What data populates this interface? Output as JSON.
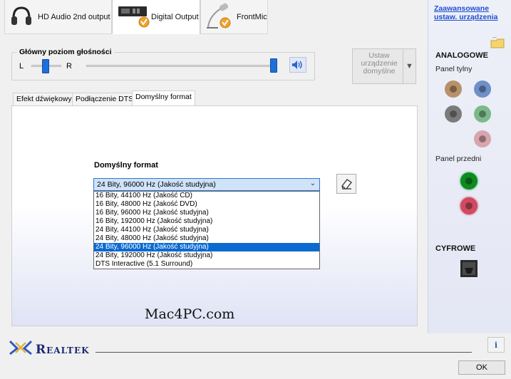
{
  "device_tabs": [
    {
      "label": "HD Audio 2nd output",
      "icon": "headphones-icon",
      "active": false
    },
    {
      "label": "Digital Output",
      "icon": "digital-output-device-icon",
      "active": true
    },
    {
      "label": "FrontMic",
      "icon": "microphone-icon",
      "active": false
    }
  ],
  "right_panel": {
    "advanced_link": "Zaawansowane ustaw. urządzenia",
    "analog_title": "ANALOGOWE",
    "rear_panel": "Panel tylny",
    "front_panel": "Panel przedni",
    "digital_title": "CYFROWE",
    "jack_colors": {
      "orange": "#b8916a",
      "blue": "#6f8fc8",
      "gray": "#7b7b7b",
      "green": "#7db88a",
      "pink": "#d7a5ae",
      "front_green": "#0f8a1f",
      "front_pink": "#d04a60"
    }
  },
  "volume": {
    "label": "Główny poziom głośności",
    "left": "L",
    "right": "R",
    "balance": 0.5,
    "level": 1.0,
    "speaker_icon": "speaker-icon"
  },
  "set_default": {
    "label": "Ustaw urządzenie domyślne",
    "arrow": "▼"
  },
  "inner_tabs": [
    {
      "label": "Efekt dźwiękowy",
      "active": false
    },
    {
      "label": "Podłączenie DTS",
      "active": false
    },
    {
      "label": "Domyślny format",
      "active": true
    }
  ],
  "default_format": {
    "title": "Domyślny format",
    "selected": "24 Bity, 96000 Hz (Jakość studyjna)",
    "options": [
      "16 Bity, 44100 Hz (Jakość CD)",
      "16 Bity, 48000 Hz (Jakość DVD)",
      "16 Bity, 96000 Hz (Jakość studyjna)",
      "16 Bity, 192000 Hz (Jakość studyjna)",
      "24 Bity, 44100 Hz (Jakość studyjna)",
      "24 Bity, 48000 Hz (Jakość studyjna)",
      "24 Bity, 96000 Hz (Jakość studyjna)",
      "24 Bity, 192000 Hz (Jakość studyjna)",
      "DTS Interactive (5.1 Surround)"
    ],
    "highlighted_index": 6
  },
  "watermark": "Mac4PC.com",
  "footer": {
    "brand": "Realtek",
    "info": "i",
    "ok": "OK"
  }
}
